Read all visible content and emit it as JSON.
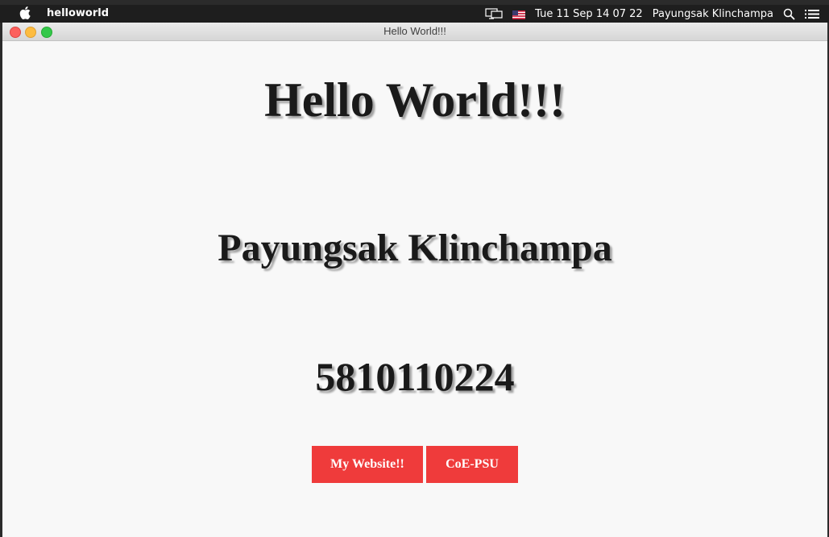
{
  "menubar": {
    "app_name": "helloworld",
    "clock": "Tue 11 Sep  14 07 22",
    "user": "Payungsak Klinchampa",
    "icons": [
      "apple-icon",
      "display-icon",
      "us-flag-icon",
      "search-icon",
      "list-icon"
    ]
  },
  "window": {
    "title": "Hello World!!!"
  },
  "content": {
    "heading": "Hello World!!!",
    "name": "Payungsak Klinchampa",
    "student_id": "5810110224",
    "buttons": {
      "website": "My Website!!",
      "coe": "CoE-PSU"
    }
  },
  "colors": {
    "button_bg": "#ef3b3b",
    "page_bg": "#f8f8f8",
    "menubar_bg": "#1e1e1e"
  }
}
